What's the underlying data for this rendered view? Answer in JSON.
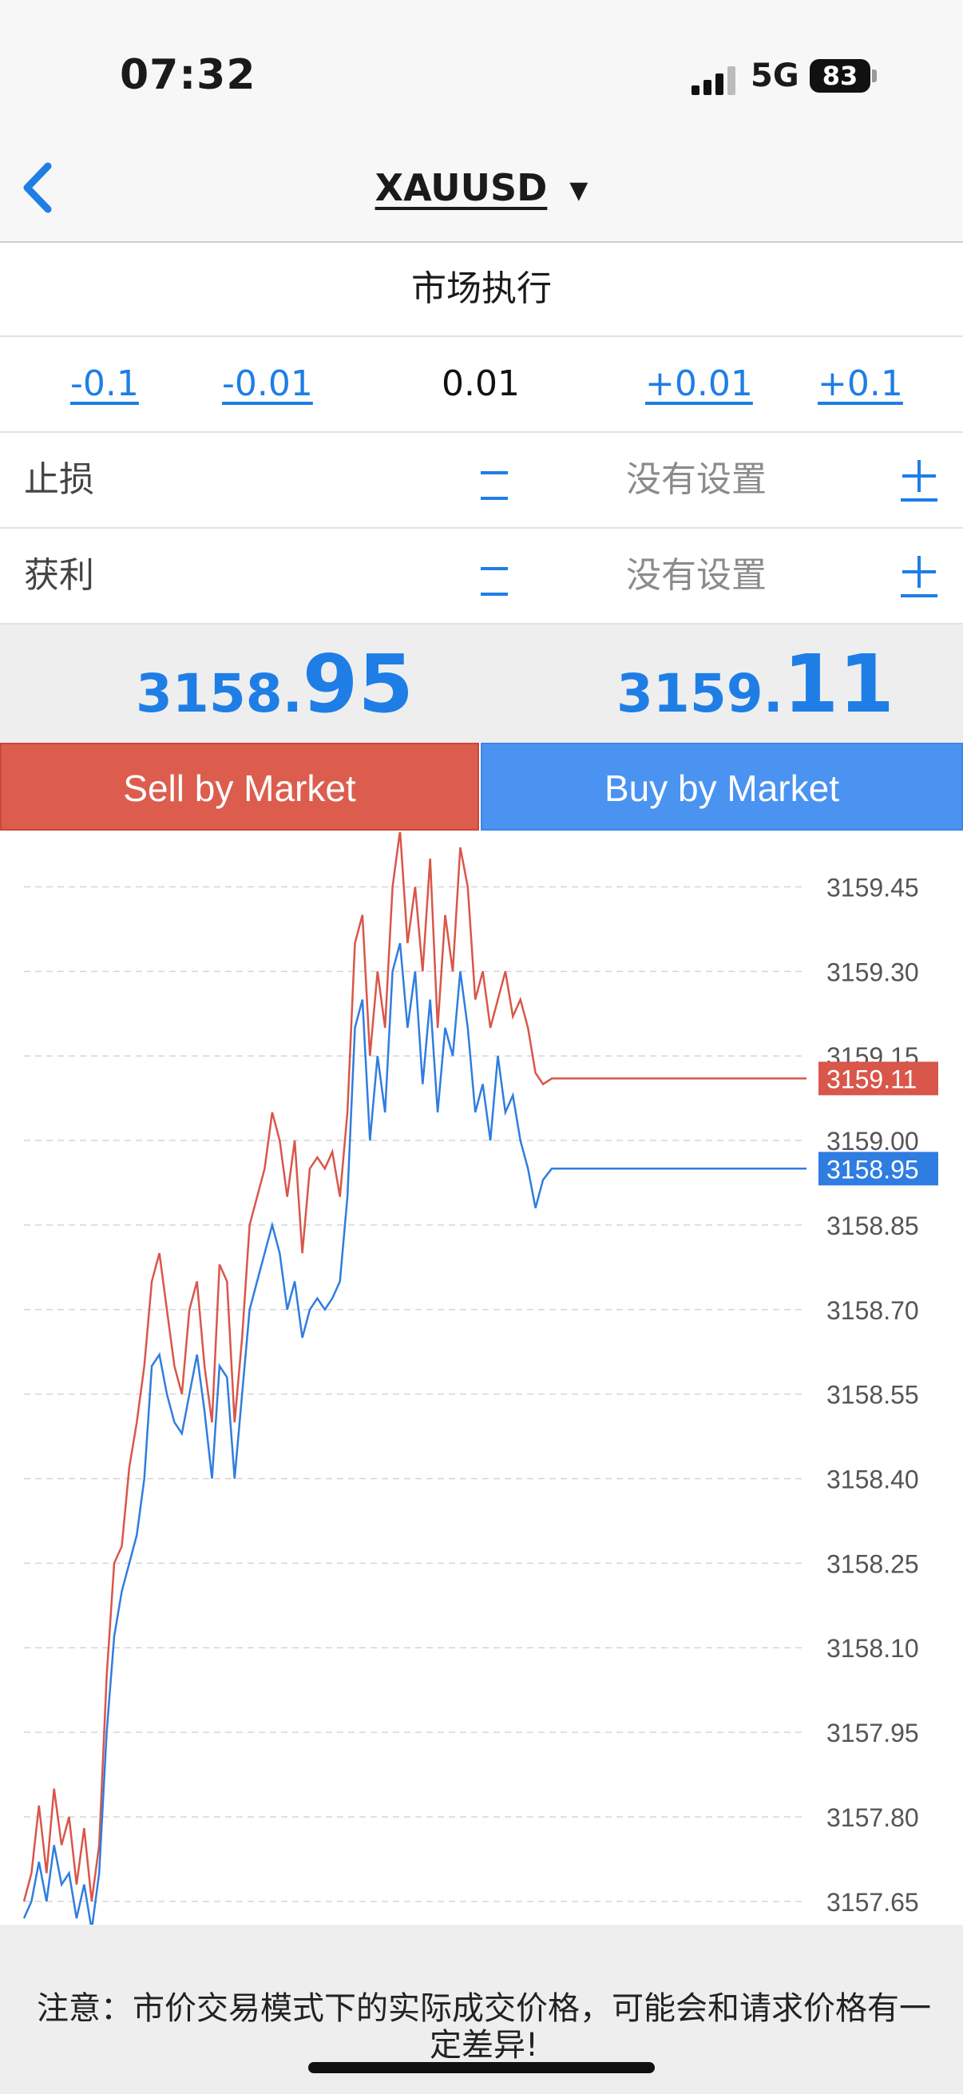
{
  "status_bar": {
    "time": "07:32",
    "network": "5G",
    "battery": "83"
  },
  "header": {
    "symbol": "XAUUSD",
    "dropdown_glyph": "▼"
  },
  "execution_mode": "市场执行",
  "volume": {
    "decrease_large": "-0.1",
    "decrease_small": "-0.01",
    "current": "0.01",
    "increase_small": "+0.01",
    "increase_large": "+0.1"
  },
  "stop_loss": {
    "label": "止损",
    "value": "没有设置"
  },
  "take_profit": {
    "label": "获利",
    "value": "没有设置"
  },
  "bid": {
    "prefix": "3158.",
    "suffix": "95"
  },
  "ask": {
    "prefix": "3159.",
    "suffix": "11"
  },
  "buttons": {
    "sell": "Sell by Market",
    "buy": "Buy by Market"
  },
  "notice": "注意：市价交易模式下的实际成交价格，可能会和请求价格有一定差异!",
  "colors": {
    "accent_blue": "#1e7ee6",
    "sell_red": "#dc5d4e",
    "buy_blue": "#4a93f0",
    "ask_line": "#d9564a",
    "bid_line": "#2f7de0"
  },
  "chart_data": {
    "type": "line",
    "grid": true,
    "y_ticks": [
      "3159.45",
      "3159.30",
      "3159.15",
      "3159.00",
      "3158.85",
      "3158.70",
      "3158.55",
      "3158.40",
      "3158.25",
      "3158.10",
      "3157.95",
      "3157.80",
      "3157.65"
    ],
    "ylim": [
      3157.62,
      3159.53
    ],
    "current_ask_label": "3159.11",
    "current_bid_label": "3158.95",
    "series": [
      {
        "role": "ask",
        "color": "#d9564a",
        "values": [
          3157.65,
          3157.7,
          3157.82,
          3157.7,
          3157.85,
          3157.75,
          3157.8,
          3157.68,
          3157.78,
          3157.65,
          3157.75,
          3158.05,
          3158.25,
          3158.28,
          3158.42,
          3158.5,
          3158.6,
          3158.75,
          3158.8,
          3158.7,
          3158.6,
          3158.55,
          3158.7,
          3158.75,
          3158.6,
          3158.5,
          3158.78,
          3158.75,
          3158.5,
          3158.65,
          3158.85,
          3158.9,
          3158.95,
          3159.05,
          3159.0,
          3158.9,
          3159.0,
          3158.8,
          3158.95,
          3158.97,
          3158.95,
          3158.98,
          3158.9,
          3159.05,
          3159.35,
          3159.4,
          3159.15,
          3159.3,
          3159.2,
          3159.45,
          3159.55,
          3159.35,
          3159.45,
          3159.3,
          3159.5,
          3159.2,
          3159.4,
          3159.3,
          3159.52,
          3159.45,
          3159.25,
          3159.3,
          3159.2,
          3159.25,
          3159.3,
          3159.22,
          3159.25,
          3159.2,
          3159.12,
          3159.1,
          3159.11,
          3159.11,
          3159.11,
          3159.11,
          3159.11,
          3159.11,
          3159.11,
          3159.11,
          3159.11,
          3159.11,
          3159.11,
          3159.11,
          3159.11,
          3159.11,
          3159.11,
          3159.11,
          3159.11,
          3159.11,
          3159.11,
          3159.11,
          3159.11,
          3159.11,
          3159.11,
          3159.11,
          3159.11,
          3159.11,
          3159.11,
          3159.11,
          3159.11,
          3159.11
        ]
      },
      {
        "role": "bid",
        "color": "#2f7de0",
        "values": [
          3157.62,
          3157.65,
          3157.72,
          3157.65,
          3157.75,
          3157.68,
          3157.7,
          3157.62,
          3157.68,
          3157.6,
          3157.7,
          3157.95,
          3158.12,
          3158.2,
          3158.25,
          3158.3,
          3158.4,
          3158.6,
          3158.62,
          3158.55,
          3158.5,
          3158.48,
          3158.55,
          3158.62,
          3158.52,
          3158.4,
          3158.6,
          3158.58,
          3158.4,
          3158.55,
          3158.7,
          3158.75,
          3158.8,
          3158.85,
          3158.8,
          3158.7,
          3158.75,
          3158.65,
          3158.7,
          3158.72,
          3158.7,
          3158.72,
          3158.75,
          3158.9,
          3159.2,
          3159.25,
          3159.0,
          3159.15,
          3159.05,
          3159.3,
          3159.35,
          3159.2,
          3159.3,
          3159.1,
          3159.25,
          3159.05,
          3159.2,
          3159.15,
          3159.3,
          3159.2,
          3159.05,
          3159.1,
          3159.0,
          3159.15,
          3159.05,
          3159.08,
          3159.0,
          3158.95,
          3158.88,
          3158.93,
          3158.95,
          3158.95,
          3158.95,
          3158.95,
          3158.95,
          3158.95,
          3158.95,
          3158.95,
          3158.95,
          3158.95,
          3158.95,
          3158.95,
          3158.95,
          3158.95,
          3158.95,
          3158.95,
          3158.95,
          3158.95,
          3158.95,
          3158.95,
          3158.95,
          3158.95,
          3158.95,
          3158.95,
          3158.95,
          3158.95,
          3158.95,
          3158.95,
          3158.95,
          3158.95
        ]
      }
    ]
  }
}
